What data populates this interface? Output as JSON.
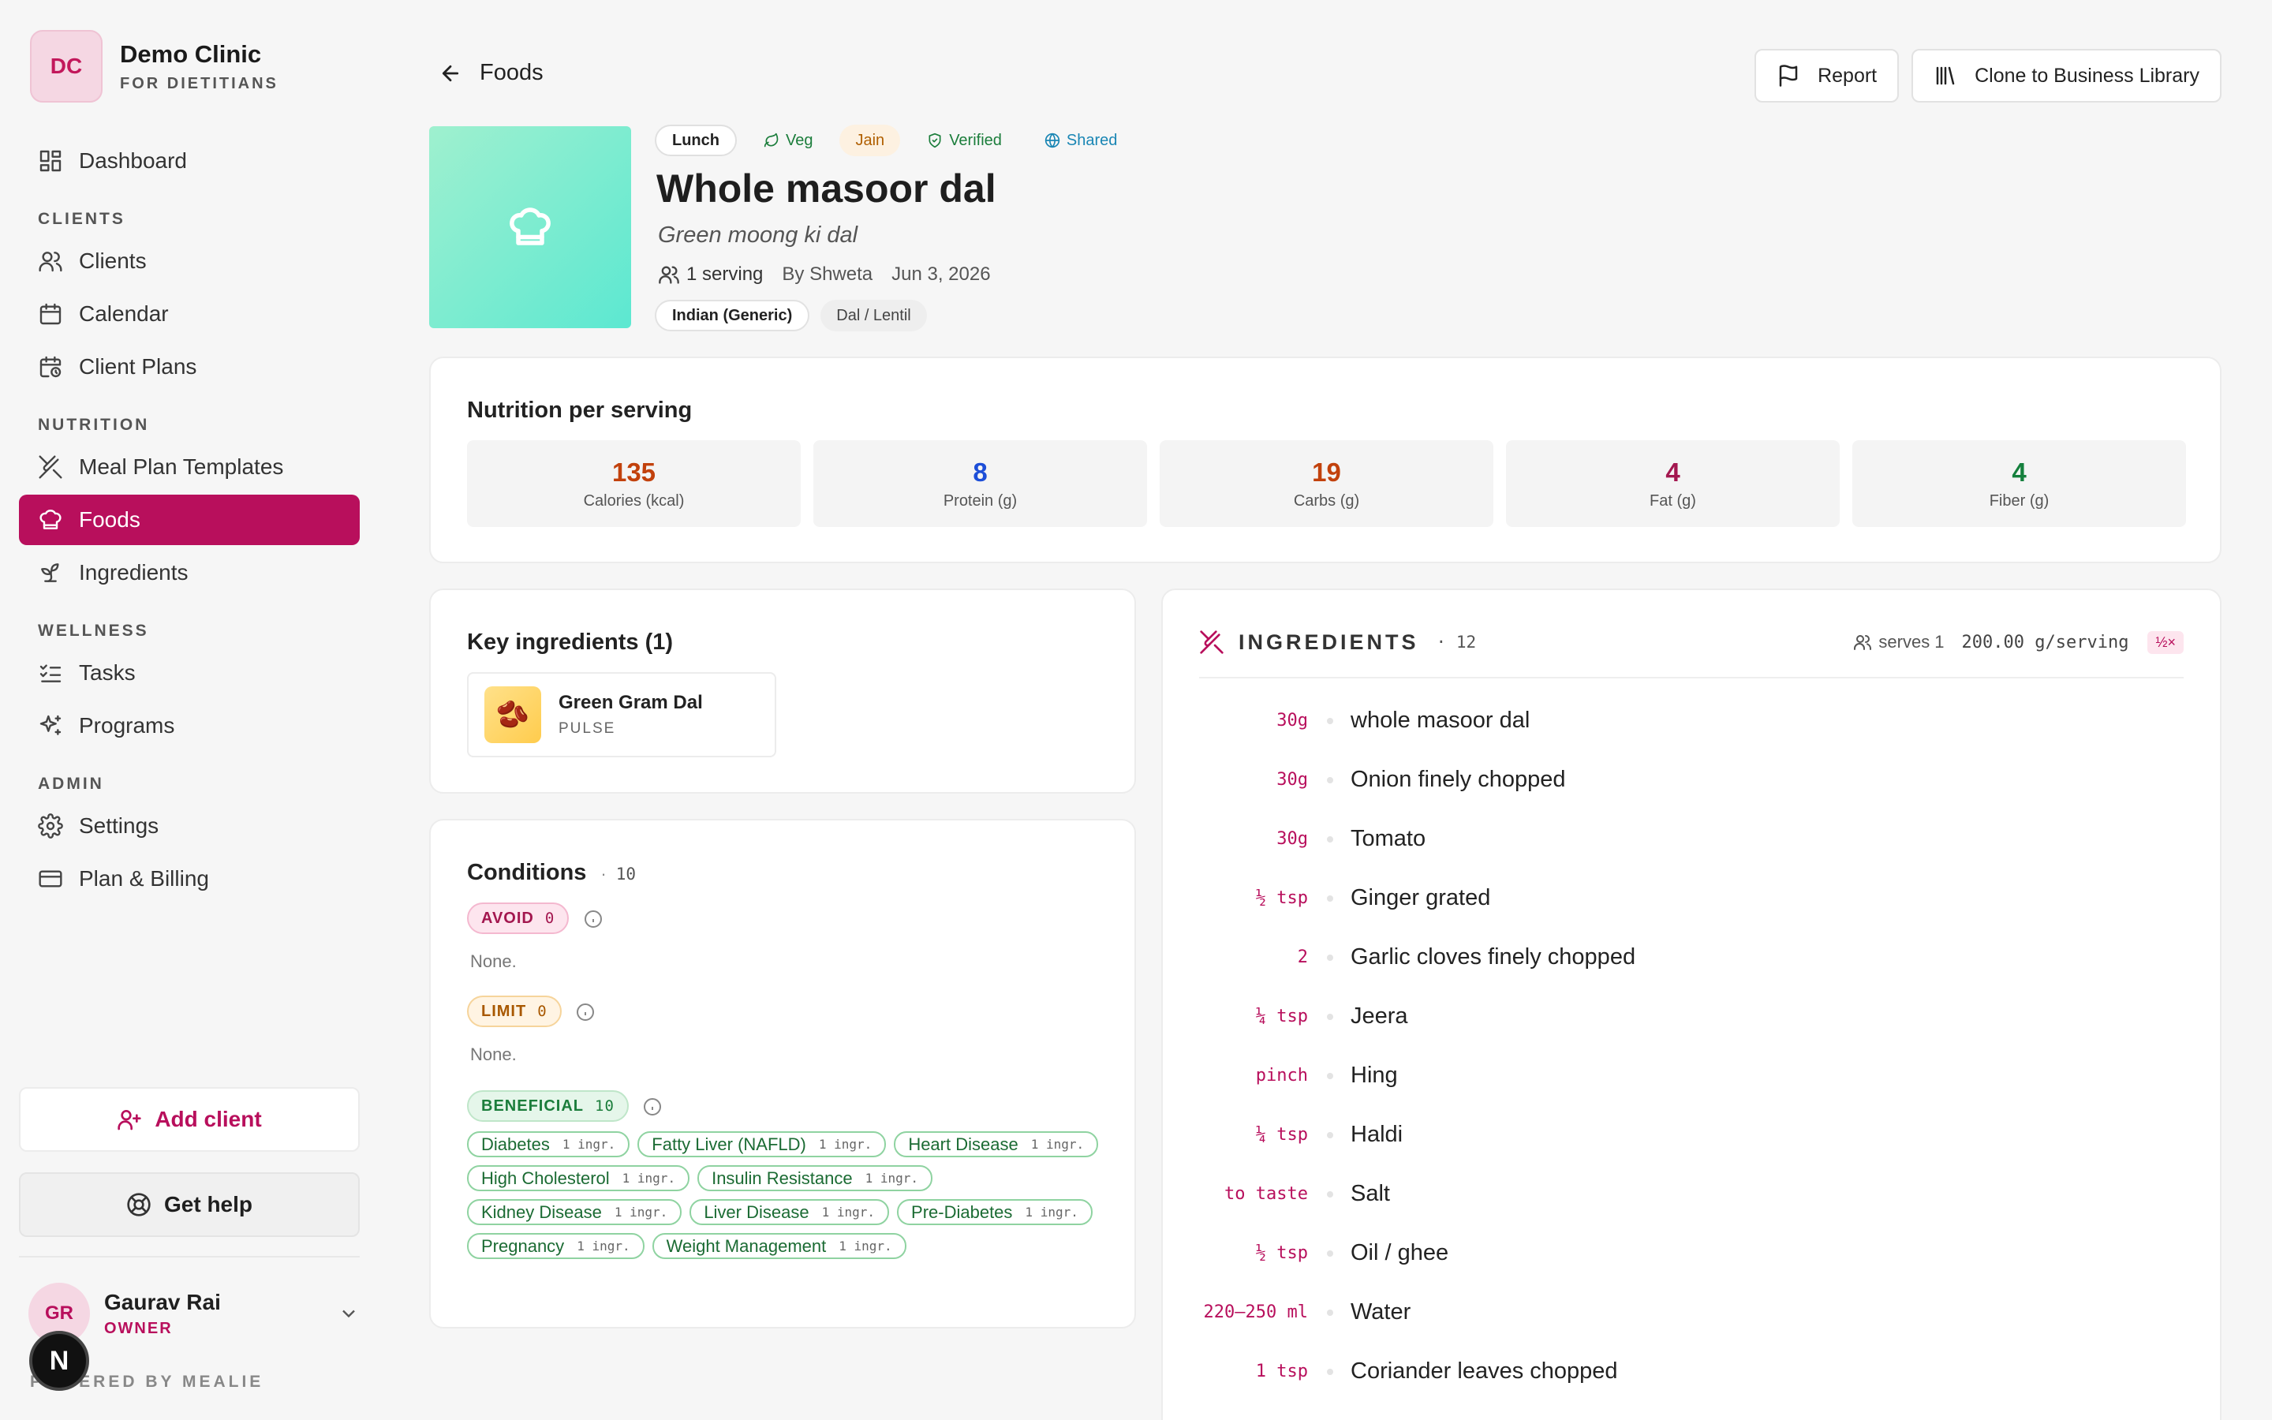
{
  "brand": {
    "initials": "DC",
    "name": "Demo Clinic",
    "subtitle": "FOR DIETITIANS"
  },
  "nav": {
    "dashboard": "Dashboard",
    "clients_section": "CLIENTS",
    "clients": "Clients",
    "calendar": "Calendar",
    "client_plans": "Client Plans",
    "nutrition_section": "NUTRITION",
    "meal_plan_templates": "Meal Plan Templates",
    "foods": "Foods",
    "ingredients": "Ingredients",
    "wellness_section": "WELLNESS",
    "tasks": "Tasks",
    "programs": "Programs",
    "admin_section": "ADMIN",
    "settings": "Settings",
    "plan_billing": "Plan & Billing"
  },
  "sidebar_actions": {
    "add_client": "Add client",
    "get_help": "Get help"
  },
  "user": {
    "initials": "GR",
    "name": "Gaurav Rai",
    "role": "OWNER"
  },
  "footer": {
    "powered": "POWERED BY MEALIE",
    "badge": "N"
  },
  "header": {
    "back_label": "Foods",
    "report": "Report",
    "clone": "Clone to Business Library"
  },
  "food": {
    "tags": {
      "meal": "Lunch",
      "veg": "Veg",
      "jain": "Jain",
      "verified": "Verified",
      "shared": "Shared"
    },
    "title": "Whole masoor dal",
    "subtitle": "Green moong ki dal",
    "servings": "1 serving",
    "author": "By Shweta",
    "date": "Jun 3, 2026",
    "cuisine": "Indian (Generic)",
    "category": "Dal / Lentil"
  },
  "nutrition": {
    "title": "Nutrition per serving",
    "items": [
      {
        "value": "135",
        "label": "Calories (kcal)",
        "color": "#c2410c"
      },
      {
        "value": "8",
        "label": "Protein (g)",
        "color": "#1d4ed8"
      },
      {
        "value": "19",
        "label": "Carbs (g)",
        "color": "#c2410c"
      },
      {
        "value": "4",
        "label": "Fat (g)",
        "color": "#a3174f"
      },
      {
        "value": "4",
        "label": "Fiber (g)",
        "color": "#15803d"
      }
    ]
  },
  "key_ingredients": {
    "title": "Key ingredients (1)",
    "items": [
      {
        "name": "Green Gram Dal",
        "type": "PULSE",
        "emoji": "🫘"
      }
    ]
  },
  "conditions": {
    "title": "Conditions",
    "count": "10",
    "avoid": {
      "label": "AVOID",
      "count": "0",
      "none": "None."
    },
    "limit": {
      "label": "LIMIT",
      "count": "0",
      "none": "None."
    },
    "beneficial": {
      "label": "BENEFICIAL",
      "count": "10"
    },
    "tags": [
      {
        "name": "Diabetes",
        "info": "1 ingr."
      },
      {
        "name": "Fatty Liver (NAFLD)",
        "info": "1 ingr."
      },
      {
        "name": "Heart Disease",
        "info": "1 ingr."
      },
      {
        "name": "High Cholesterol",
        "info": "1 ingr."
      },
      {
        "name": "Insulin Resistance",
        "info": "1 ingr."
      },
      {
        "name": "Kidney Disease",
        "info": "1 ingr."
      },
      {
        "name": "Liver Disease",
        "info": "1 ingr."
      },
      {
        "name": "Pre-Diabetes",
        "info": "1 ingr."
      },
      {
        "name": "Pregnancy",
        "info": "1 ingr."
      },
      {
        "name": "Weight Management",
        "info": "1 ingr."
      }
    ]
  },
  "ingredients": {
    "title": "INGREDIENTS",
    "count": "· 12",
    "serves": "serves 1",
    "per_serving": "200.00 g/serving",
    "scale": "½×",
    "items": [
      {
        "qty": "30g",
        "name": "whole masoor dal"
      },
      {
        "qty": "30g",
        "name": "Onion finely chopped"
      },
      {
        "qty": "30g",
        "name": "Tomato"
      },
      {
        "qty": "½ tsp",
        "name": "Ginger grated"
      },
      {
        "qty": "2",
        "name": "Garlic cloves finely chopped"
      },
      {
        "qty": "¼ tsp",
        "name": "Jeera"
      },
      {
        "qty": "pinch",
        "name": "Hing"
      },
      {
        "qty": "¼ tsp",
        "name": "Haldi"
      },
      {
        "qty": "to taste",
        "name": "Salt"
      },
      {
        "qty": "½ tsp",
        "name": "Oil / ghee"
      },
      {
        "qty": "220–250 ml",
        "name": "Water"
      },
      {
        "qty": "1 tsp",
        "name": "Coriander leaves chopped"
      }
    ]
  }
}
